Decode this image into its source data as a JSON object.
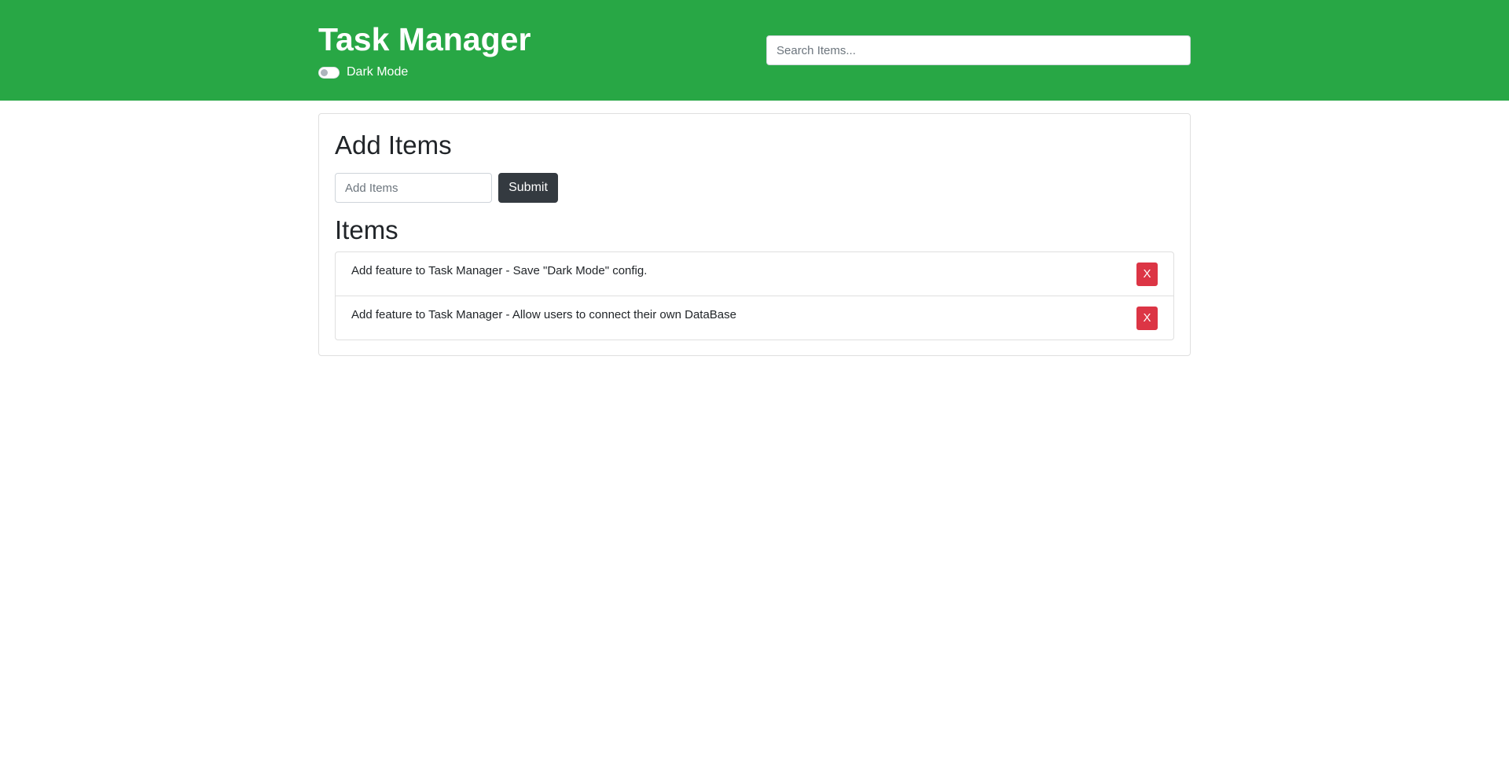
{
  "colors": {
    "header_bg": "#28a745",
    "submit_bg": "#343a40",
    "delete_bg": "#dc3545"
  },
  "header": {
    "title": "Task Manager",
    "dark_mode_label": "Dark Mode",
    "dark_mode_on": false,
    "search_placeholder": "Search Items..."
  },
  "add_section": {
    "title": "Add Items",
    "input_placeholder": "Add Items",
    "input_value": "",
    "submit_label": "Submit"
  },
  "items_section": {
    "title": "Items",
    "delete_label": "X",
    "items": [
      {
        "text": "Add feature to Task Manager - Save \"Dark Mode\" config."
      },
      {
        "text": "Add feature to Task Manager - Allow users to connect their own DataBase"
      }
    ]
  }
}
